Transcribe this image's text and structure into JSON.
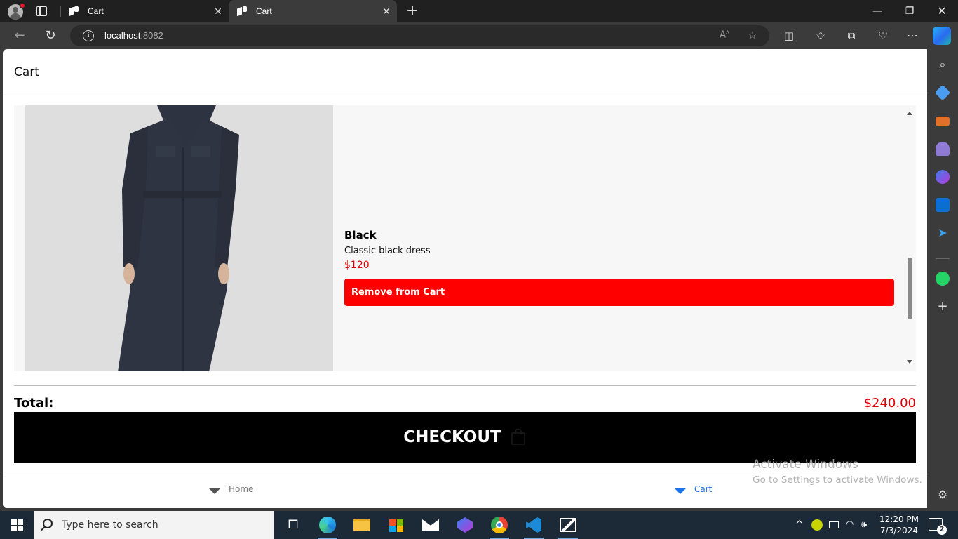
{
  "browser": {
    "tabs": [
      {
        "label": "Cart",
        "active": false
      },
      {
        "label": "Cart",
        "active": true
      }
    ],
    "url_host": "localhost",
    "url_port": ":8082"
  },
  "page": {
    "title": "Cart",
    "cart_items": [
      {
        "name": "Black",
        "description": "Classic black dress",
        "price": "$120",
        "remove_label": "Remove from Cart",
        "image": "black-dress-photo"
      }
    ],
    "total_label": "Total:",
    "total_value": "$240.00",
    "checkout_label": "CHECKOUT",
    "bottom_nav": [
      {
        "label": "Home",
        "active": false
      },
      {
        "label": "Cart",
        "active": true
      }
    ]
  },
  "watermark": {
    "line1": "Activate Windows",
    "line2": "Go to Settings to activate Windows."
  },
  "taskbar": {
    "search_placeholder": "Type here to search",
    "time": "12:20 PM",
    "date": "7/3/2024",
    "notification_count": "2"
  },
  "colors": {
    "accent_red": "#ff0000",
    "price_red": "#e00000",
    "checkout_bg": "#000000",
    "nav_active": "#1a73e8"
  }
}
